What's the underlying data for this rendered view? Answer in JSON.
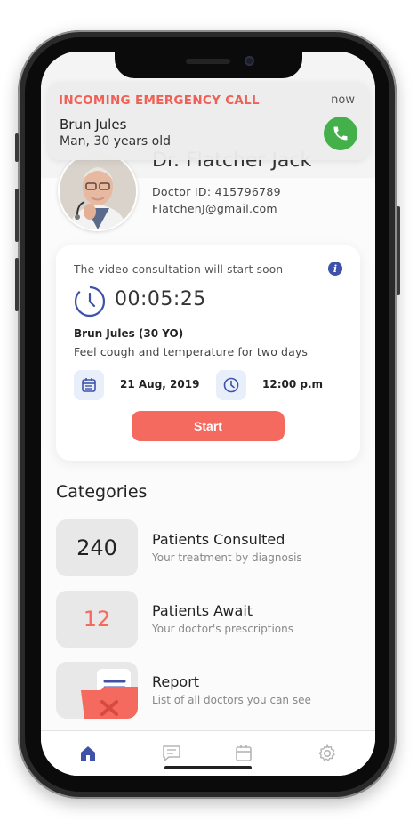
{
  "notification": {
    "title": "INCOMING EMERGENCY CALL",
    "time": "now",
    "caller_name": "Brun Jules",
    "caller_info": "Man, 30 years old",
    "call_icon": "phone-icon"
  },
  "profile": {
    "name": "Dr. Flatcher Jack",
    "doctor_id": "Doctor ID: 415796789",
    "email": "FlatchenJ@gmail.com"
  },
  "consultation": {
    "message": "The video consultation will start soon",
    "timer": "00:05:25",
    "patient_name": "Brun Jules (30 YO)",
    "patient_complaint": "Feel cough and temperature for two days",
    "date": "21 Aug, 2019",
    "time": "12:00 p.m",
    "start_label": "Start"
  },
  "categories": {
    "title": "Categories",
    "items": [
      {
        "count": "240",
        "label": "Patients Consulted",
        "sub": "Your treatment by diagnosis",
        "count_color": "#222222"
      },
      {
        "count": "12",
        "label": "Patients Await",
        "sub": "Your doctor's prescriptions",
        "count_color": "#f46a5f"
      },
      {
        "count": "",
        "label": "Report",
        "sub": "List of all doctors you can see",
        "icon": "report-folder-icon"
      }
    ]
  },
  "tabbar": {
    "tabs": [
      "home-icon",
      "chat-icon",
      "calendar-icon",
      "settings-icon"
    ],
    "active": "home-icon"
  },
  "colors": {
    "accent": "#f46a5f",
    "primary": "#3f52a9",
    "call_green": "#43b04a"
  }
}
